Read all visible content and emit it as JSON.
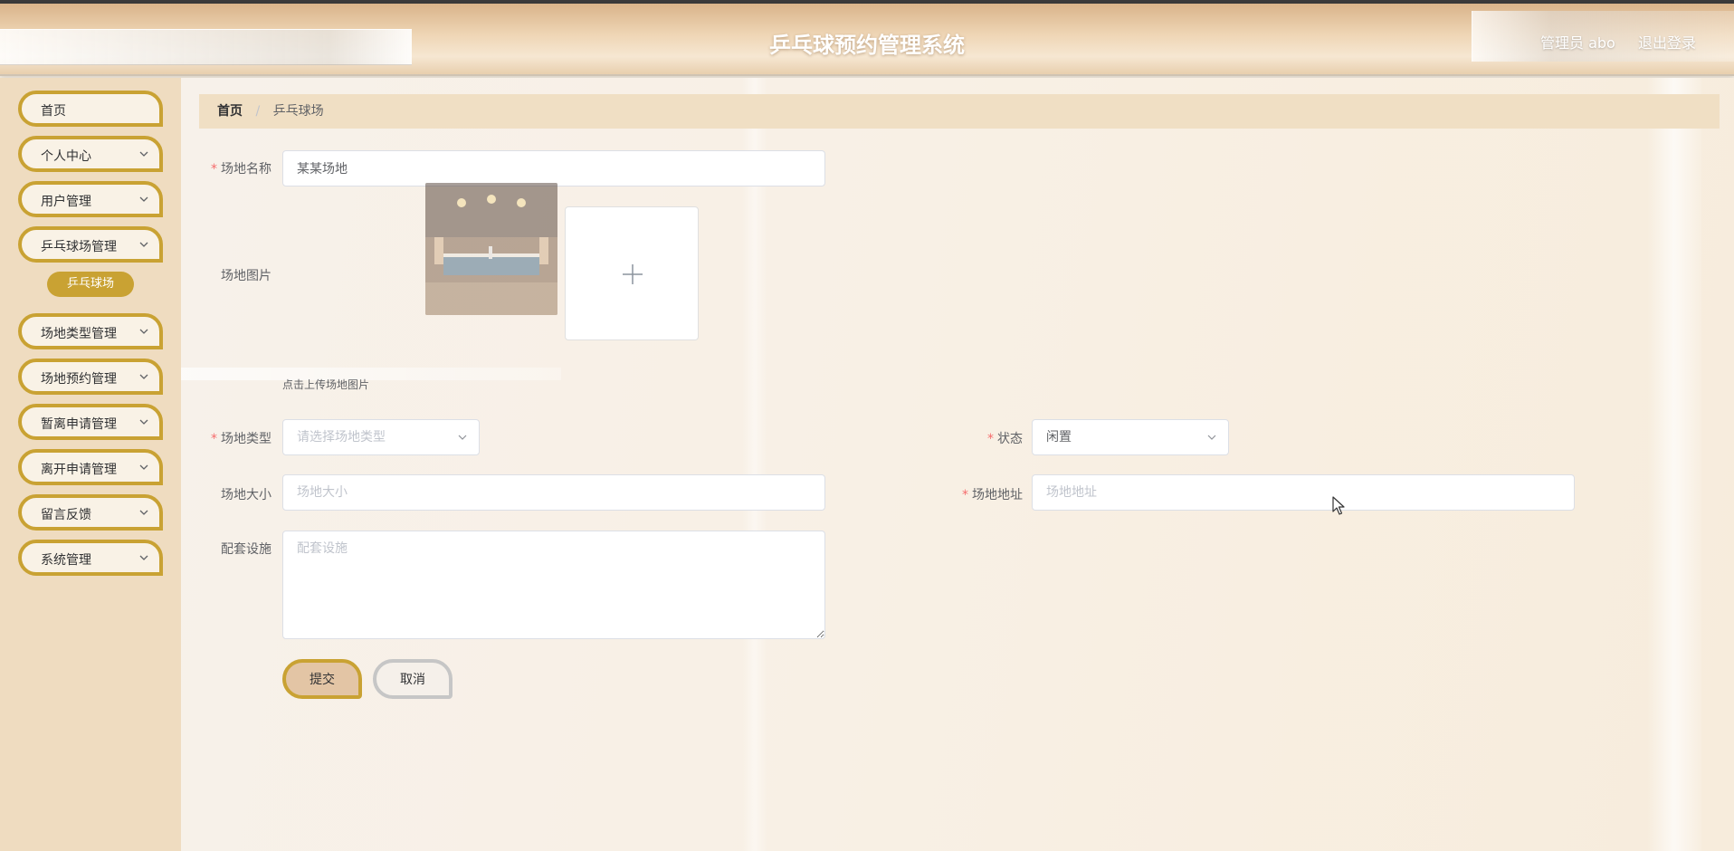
{
  "header": {
    "title": "乒乓球预约管理系统",
    "user": "管理员 abo",
    "logout": "退出登录"
  },
  "sidebar": {
    "items": [
      {
        "label": "首页",
        "has_chevron": false
      },
      {
        "label": "个人中心",
        "has_chevron": true
      },
      {
        "label": "用户管理",
        "has_chevron": true
      },
      {
        "label": "乒乓球场管理",
        "has_chevron": true
      },
      {
        "label": "场地类型管理",
        "has_chevron": true
      },
      {
        "label": "场地预约管理",
        "has_chevron": true
      },
      {
        "label": "暂离申请管理",
        "has_chevron": true
      },
      {
        "label": "离开申请管理",
        "has_chevron": true
      },
      {
        "label": "留言反馈",
        "has_chevron": true
      },
      {
        "label": "系统管理",
        "has_chevron": true
      }
    ],
    "active_sub": "乒乓球场"
  },
  "breadcrumb": {
    "home": "首页",
    "separator": "/",
    "current": "乒乓球场"
  },
  "form": {
    "name_label": "场地名称",
    "name_value": "某某场地",
    "image_label": "场地图片",
    "upload_tip": "点击上传场地图片",
    "type_label": "场地类型",
    "type_placeholder": "请选择场地类型",
    "status_label": "状态",
    "status_value": "闲置",
    "size_label": "场地大小",
    "size_placeholder": "场地大小",
    "address_label": "场地地址",
    "address_placeholder": "场地地址",
    "facilities_label": "配套设施",
    "facilities_placeholder": "配套设施",
    "required_mark": "*",
    "submit": "提交",
    "cancel": "取消"
  },
  "colors": {
    "accent_gold": "#c9a233",
    "sidebar_bg": "#efdcc0",
    "breadcrumb_bg": "#f0dfc4",
    "required": "#f56c6c"
  },
  "icons": {
    "chevron": "chevron-down-icon",
    "plus": "plus-icon",
    "cursor": "mouse-cursor-icon"
  }
}
